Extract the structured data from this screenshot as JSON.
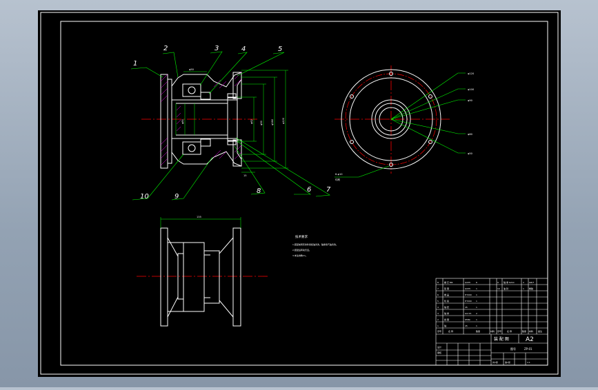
{
  "sheet": {
    "background": "#000000",
    "line_color": "#ffffff",
    "leader_color": "#00ff00",
    "centerline_color": "#ff0000",
    "hatch_color": "#ff00ff",
    "dimension_color": "#00ff00"
  },
  "part_callouts": [
    "1",
    "2",
    "3",
    "4",
    "5",
    "6",
    "7",
    "8",
    "9",
    "10"
  ],
  "dimension_texts": {
    "top_bore": "φ50",
    "front_overall": "φ120",
    "front_flange": "φ160",
    "front_inner": "φ90",
    "front_small": "φ62",
    "front_right": "φ80",
    "bottom_right": "15",
    "bottom_overall": "135",
    "circle_1": "φ120",
    "circle_2": "φ100",
    "circle_3": "φ90",
    "circle_4": "φ60",
    "circle_5": "φ50",
    "holes_line1": "6-φ10",
    "holes_line2": "均布"
  },
  "notes": {
    "title": "技术要求",
    "lines": [
      "1.装配前所有零件用煤油清洗，轴承用汽油清洗。",
      "2.装配后转动灵活。",
      "3.未注倒角C1。"
    ]
  },
  "parts_list": {
    "rows": [
      {
        "left_no": "8",
        "left_name": "螺 钉 M6",
        "left_qty": "6",
        "left_mat": "Q235",
        "right_no": "9",
        "right_name": "轴 承 6210",
        "right_qty": "2",
        "right_mat": "GB/T"
      },
      {
        "left_no": "7",
        "left_name": "垫 圈",
        "left_qty": "1",
        "left_mat": "Q235",
        "right_no": "10",
        "right_name": "油 封",
        "right_qty": "1",
        "right_mat": "橡胶"
      },
      {
        "left_no": "6",
        "left_name": "端 盖",
        "left_qty": "1",
        "left_mat": "HT200",
        "right_no": "",
        "right_name": "",
        "right_qty": "",
        "right_mat": ""
      },
      {
        "left_no": "5",
        "left_name": "轮 毂",
        "left_qty": "1",
        "left_mat": "HT200",
        "right_no": "",
        "right_name": "",
        "right_qty": "",
        "right_mat": ""
      },
      {
        "left_no": "4",
        "left_name": "轴 套",
        "left_qty": "1",
        "left_mat": "45",
        "right_no": "",
        "right_name": "",
        "right_qty": "",
        "right_mat": ""
      },
      {
        "left_no": "3",
        "left_name": "轴 承",
        "left_qty": "2",
        "left_mat": "GCr15",
        "right_no": "",
        "right_name": "",
        "right_qty": "",
        "right_mat": ""
      },
      {
        "left_no": "2",
        "left_name": "挡 圈",
        "left_qty": "1",
        "left_mat": "65Mn",
        "right_no": "",
        "right_name": "",
        "right_qty": "",
        "right_mat": ""
      },
      {
        "left_no": "1",
        "left_name": "轴",
        "left_qty": "1",
        "left_mat": "45",
        "right_no": "",
        "right_name": "",
        "right_qty": "",
        "right_mat": ""
      }
    ],
    "header": {
      "no": "序号",
      "name": "名 称",
      "qty": "数量",
      "mat": "材料",
      "no2": "序号",
      "name2": "名 称",
      "qty2": "数量",
      "mat2": "材料",
      "note": "备注"
    }
  },
  "title_block": {
    "drawing_name": "装 配 图",
    "sheet_size": "A2",
    "drawing_no": "ZP-01",
    "scale": "1:1",
    "designer": "设计",
    "checker": "审核",
    "sheet": "共1张",
    "sheet_no": "第1张",
    "org": "图号"
  }
}
